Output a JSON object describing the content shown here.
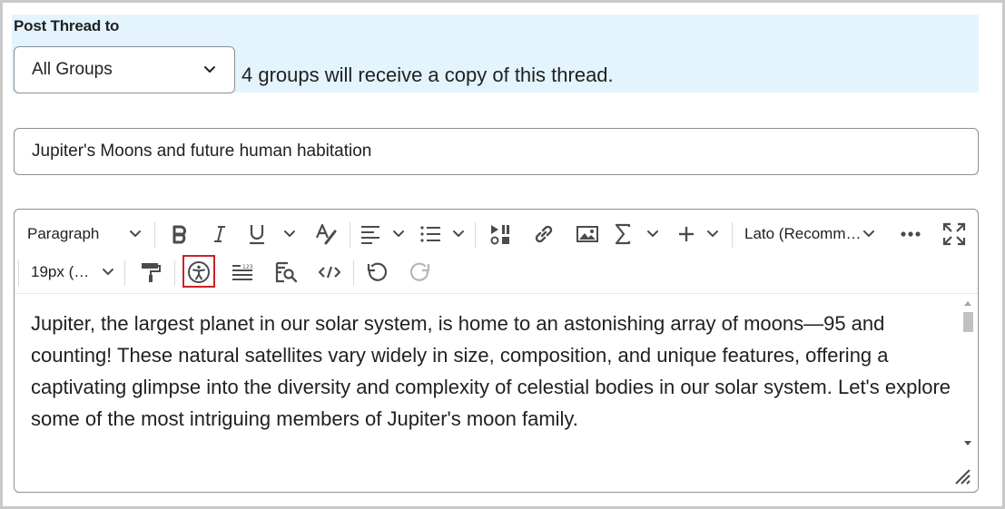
{
  "post_thread": {
    "title": "Post Thread to",
    "group_select_value": "All Groups",
    "group_note": "4 groups will receive a copy of this thread."
  },
  "subject": {
    "value": "Jupiter's Moons and future human habitation"
  },
  "editor": {
    "toolbar": {
      "block_format": "Paragraph",
      "font_family": "Lato (Recomm…",
      "font_size": "19px (…"
    },
    "content": "Jupiter, the largest planet in our solar system, is home to an astonishing array of moons—95 and counting! These natural satellites vary widely in size, composition, and unique features, offering a captivating glimpse into the diversity and complexity of celestial bodies in our solar system. Let's explore some of the most intriguing members of Jupiter's moon family.",
    "icons": {
      "bold": "bold-icon",
      "italic": "italic-icon",
      "underline": "underline-icon",
      "format_painter_text": "text-style-icon",
      "align": "align-left-icon",
      "list": "bullet-list-icon",
      "insert_stuff": "insert-stuff-icon",
      "link": "link-icon",
      "image": "image-icon",
      "equation": "sigma-icon",
      "insert_more": "plus-icon",
      "more": "ellipsis-icon",
      "fullscreen": "fullscreen-icon",
      "format_painter": "paint-roller-icon",
      "accessibility": "accessibility-checker-icon",
      "word_count": "word-count-icon",
      "find_replace": "find-replace-icon",
      "source_code": "source-code-icon",
      "undo": "undo-icon",
      "redo": "redo-icon"
    },
    "highlight_color": "#cd2026"
  }
}
